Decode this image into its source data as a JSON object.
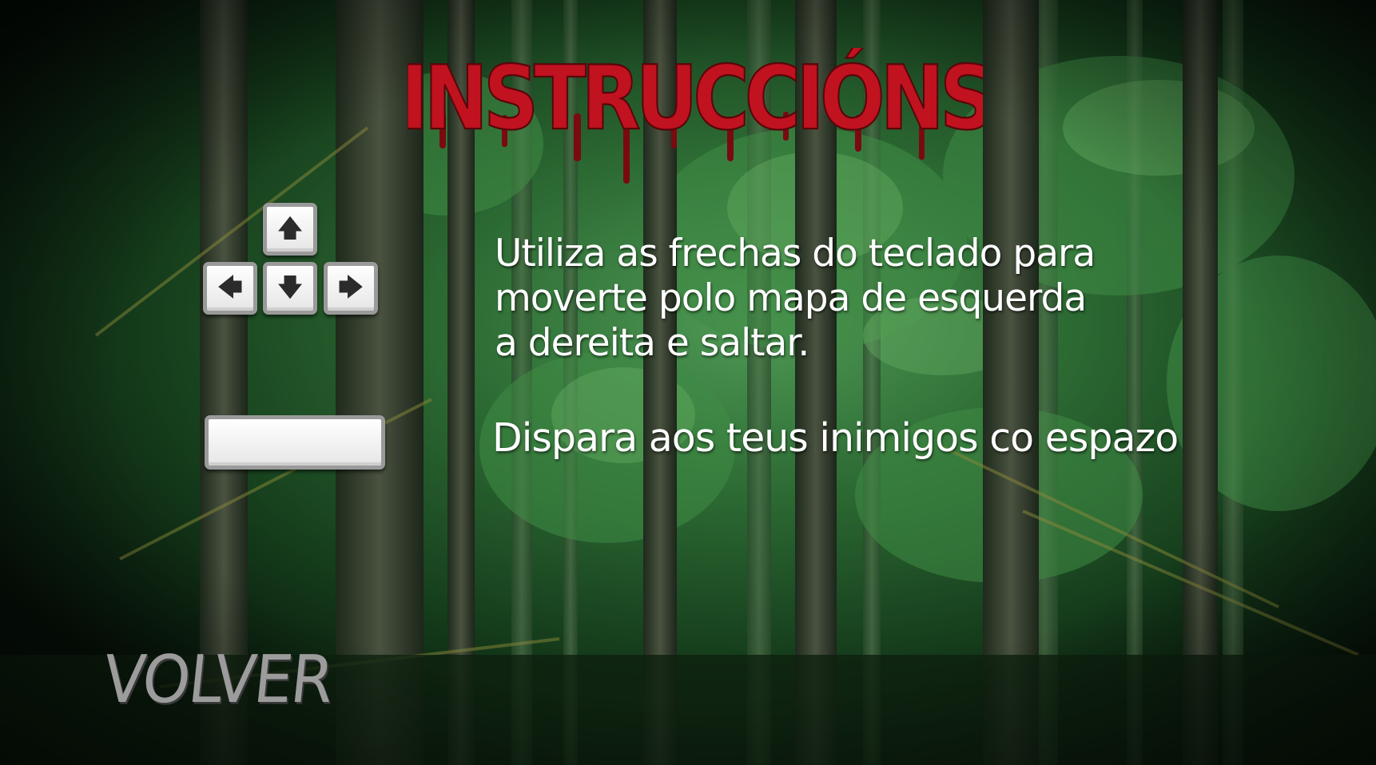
{
  "screen": {
    "title": "INSTRUCCIÓNS",
    "title_color": "#c1121f",
    "title_drip_color": "#7a0a10"
  },
  "controls": {
    "arrow_keys": {
      "up": "🡅",
      "left": "🡄",
      "down": "🡇",
      "right": "🡆",
      "icons": [
        "arrow-up-icon",
        "arrow-left-icon",
        "arrow-down-icon",
        "arrow-right-icon"
      ]
    },
    "space_key": {
      "label": "",
      "icon": "spacebar-key"
    }
  },
  "instructions": {
    "move_lines": [
      "Utiliza as frechas do teclado para",
      "moverte polo mapa de esquerda",
      "a dereita e saltar."
    ],
    "shoot": "Dispara aos teus inimigos co espazo"
  },
  "navigation": {
    "back_label": "VOLVER"
  },
  "colors": {
    "background_dark": "#0b1a0d",
    "foliage": "#2f7a3a",
    "text": "#ffffff",
    "back_button": "#9c9c9c"
  }
}
